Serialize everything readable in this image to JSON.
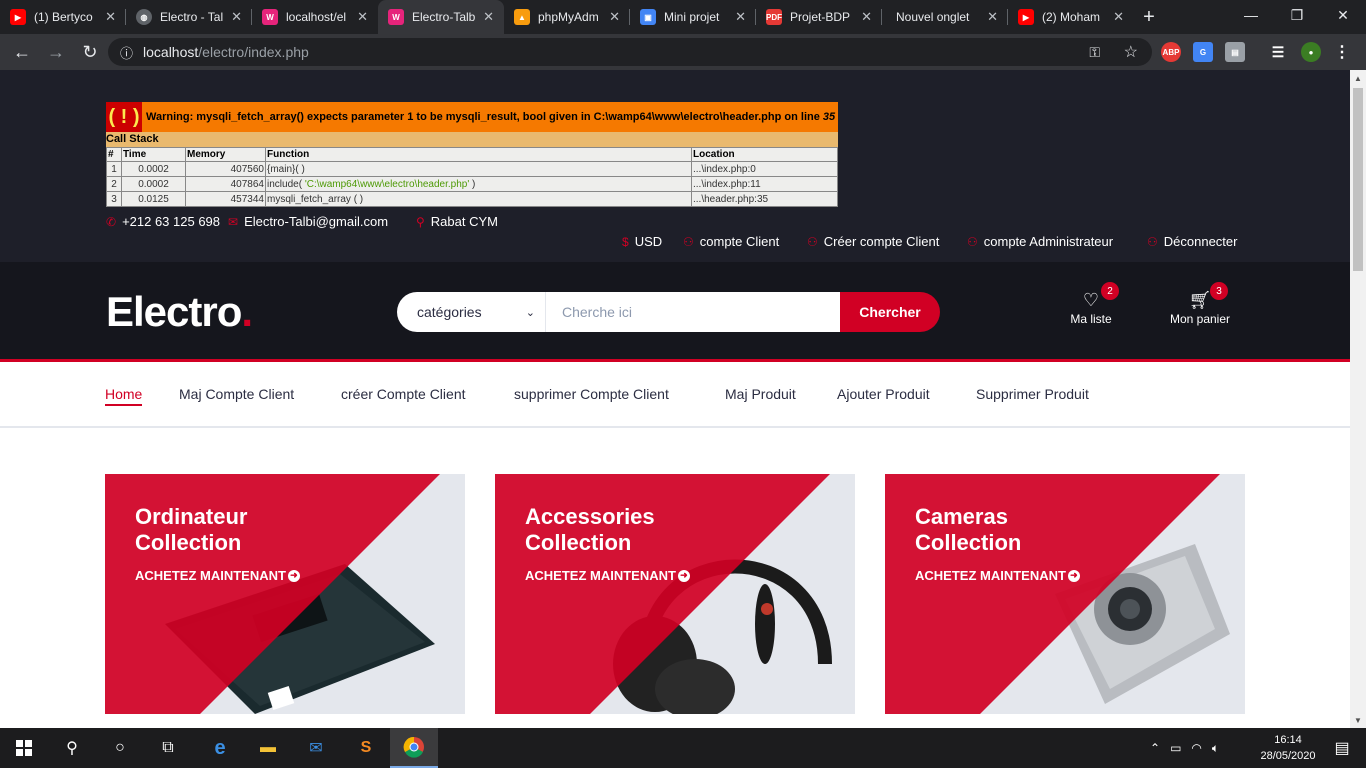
{
  "browser": {
    "tabs": [
      {
        "title": "(1) Bertyco",
        "icon": "youtube-icon",
        "color": "#ff0000"
      },
      {
        "title": "Electro - Tal",
        "icon": "globe-icon",
        "color": "#5f6368"
      },
      {
        "title": "localhost/el",
        "icon": "wamp-icon",
        "color": "#e6247b"
      },
      {
        "title": "Electro-Talb",
        "icon": "wamp-icon",
        "color": "#e6247b",
        "active": true
      },
      {
        "title": "phpMyAdm",
        "icon": "phpmyadmin-icon",
        "color": "#f89c0e"
      },
      {
        "title": "Mini projet",
        "icon": "doc-icon",
        "color": "#4285f4"
      },
      {
        "title": "Projet-BDP",
        "icon": "pdf-icon",
        "color": "#e53935"
      },
      {
        "title": "Nouvel onglet",
        "icon": "",
        "color": ""
      },
      {
        "title": "(2) Moham",
        "icon": "youtube-icon",
        "color": "#ff0000"
      }
    ],
    "url_host": "localhost",
    "url_path": "/electro/index.php"
  },
  "xdebug": {
    "warning_symbol": "( ! )",
    "warning_text": "Warning: mysqli_fetch_array() expects parameter 1 to be mysqli_result, bool given in C:\\wamp64\\www\\electro\\header.php on line",
    "warning_line": "35",
    "callstack_label": "Call Stack",
    "columns": [
      "#",
      "Time",
      "Memory",
      "Function",
      "Location"
    ],
    "rows": [
      {
        "n": "1",
        "time": "0.0002",
        "memory": "407560",
        "func": "{main}( )",
        "func_arg": "",
        "func_end": "",
        "location": "...\\index.php:0"
      },
      {
        "n": "2",
        "time": "0.0002",
        "memory": "407864",
        "func": "include( ",
        "func_arg": "'C:\\wamp64\\www\\electro\\header.php'",
        "func_end": " )",
        "location": "...\\index.php:11"
      },
      {
        "n": "3",
        "time": "0.0125",
        "memory": "457344",
        "func": "mysqli_fetch_array ( )",
        "func_arg": "",
        "func_end": "",
        "location": "...\\header.php:35"
      }
    ]
  },
  "contact": {
    "phone": "+212 63 125 698",
    "email": "Electro-Talbi@gmail.com",
    "location": "Rabat CYM"
  },
  "header_links": {
    "currency": "USD",
    "client_account": "compte Client",
    "create_account": "Créer compte Client",
    "admin_account": "compte Administrateur",
    "logout": "Déconnecter"
  },
  "main_header": {
    "logo": "Electro",
    "logo_dot": ".",
    "category_select": "catégories",
    "search_placeholder": "Cherche ici",
    "search_button": "Chercher",
    "wishlist_label": "Ma liste",
    "wishlist_count": "2",
    "cart_label": "Mon panier",
    "cart_count": "3"
  },
  "nav": {
    "items": [
      "Home",
      "Maj Compte Client",
      "créer Compte Client",
      "supprimer Compte Client",
      "Maj Produit",
      "Ajouter Produit",
      "Supprimer Produit"
    ]
  },
  "shop": {
    "cta": "ACHETEZ MAINTENANT",
    "items": [
      {
        "title1": "Ordinateur",
        "title2": "Collection"
      },
      {
        "title1": "Accessories",
        "title2": "Collection"
      },
      {
        "title1": "Cameras",
        "title2": "Collection"
      }
    ]
  },
  "taskbar": {
    "time": "16:14",
    "date": "28/05/2020"
  },
  "colors": {
    "accent": "#d10024",
    "header_dark": "#15161d",
    "top_dark": "#1e1f29"
  }
}
